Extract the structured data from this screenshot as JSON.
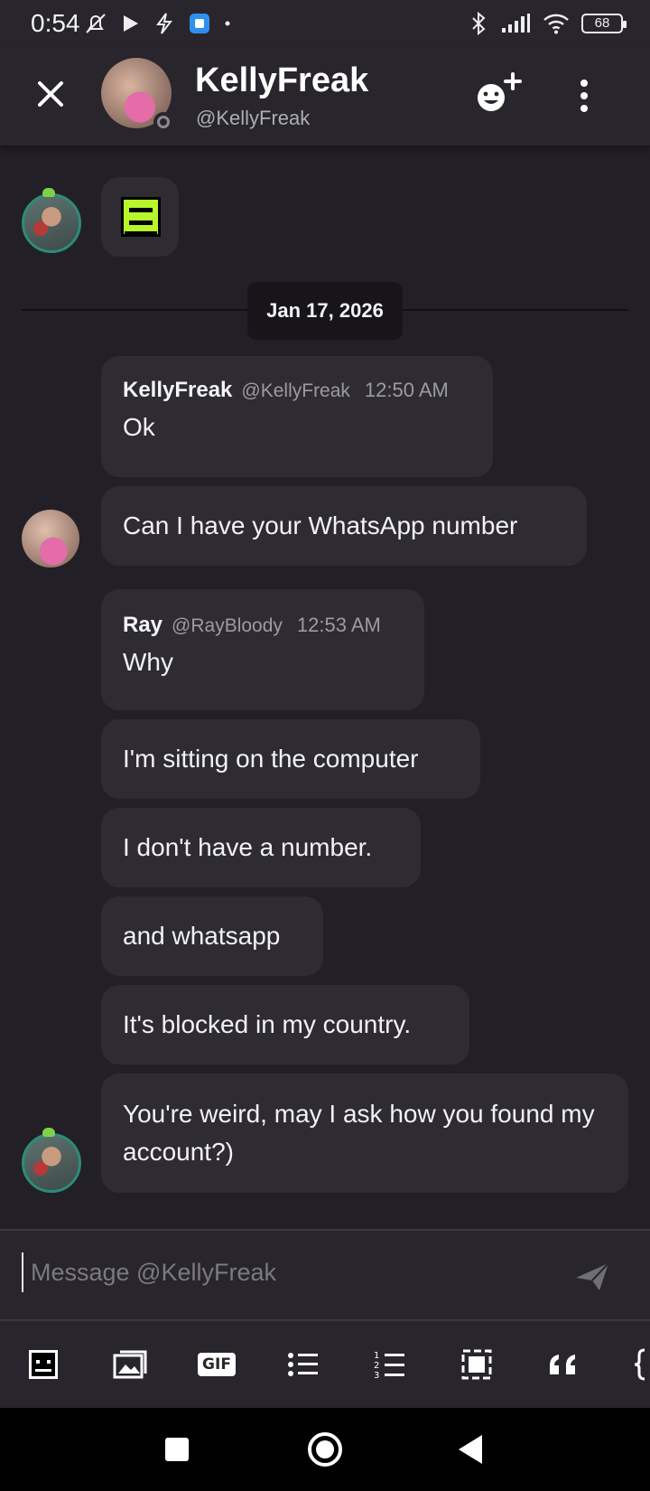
{
  "status_bar": {
    "time": "0:54",
    "battery": "68",
    "icons": [
      "mute-bell-icon",
      "play-icon",
      "flash-icon",
      "app-icon",
      "dot-icon",
      "bluetooth-icon",
      "signal-icon",
      "wifi-icon",
      "battery-icon"
    ]
  },
  "header": {
    "name": "KellyFreak",
    "handle": "@KellyFreak",
    "presence": "offline"
  },
  "chat": {
    "date_separator": "Jan 17, 2026",
    "messages": [
      {
        "author": "",
        "handle": "",
        "time": "",
        "text": "",
        "type": "sticker"
      },
      {
        "author": "KellyFreak",
        "handle": "@KellyFreak",
        "time": "12:50 AM",
        "text": "Ok"
      },
      {
        "author": "",
        "handle": "",
        "time": "",
        "text": "Can I have your WhatsApp number"
      },
      {
        "author": "Ray",
        "handle": "@RayBloody",
        "time": "12:53 AM",
        "text": "Why"
      },
      {
        "author": "",
        "handle": "",
        "time": "",
        "text": "I'm sitting on the computer"
      },
      {
        "author": "",
        "handle": "",
        "time": "",
        "text": "I don't have a number."
      },
      {
        "author": "",
        "handle": "",
        "time": "",
        "text": "and whatsapp"
      },
      {
        "author": "",
        "handle": "",
        "time": "",
        "text": "It's blocked in my country."
      },
      {
        "author": "",
        "handle": "",
        "time": "",
        "text": "You're weird, may I ask how you found my account?)"
      }
    ]
  },
  "composer": {
    "placeholder": "Message @KellyFreak",
    "value": ""
  },
  "toolbar": {
    "gif_label": "GIF",
    "items": [
      "emoji-face-icon",
      "image-icon",
      "gif-icon",
      "bullet-list-icon",
      "numbered-list-icon",
      "spoiler-icon",
      "quote-icon",
      "code-icon"
    ]
  },
  "colors": {
    "background": "#221f26",
    "bubble": "#2e2b33",
    "header": "#28252c",
    "muted_text": "#9c9aa3",
    "sticker_green": "#b8f52b"
  }
}
